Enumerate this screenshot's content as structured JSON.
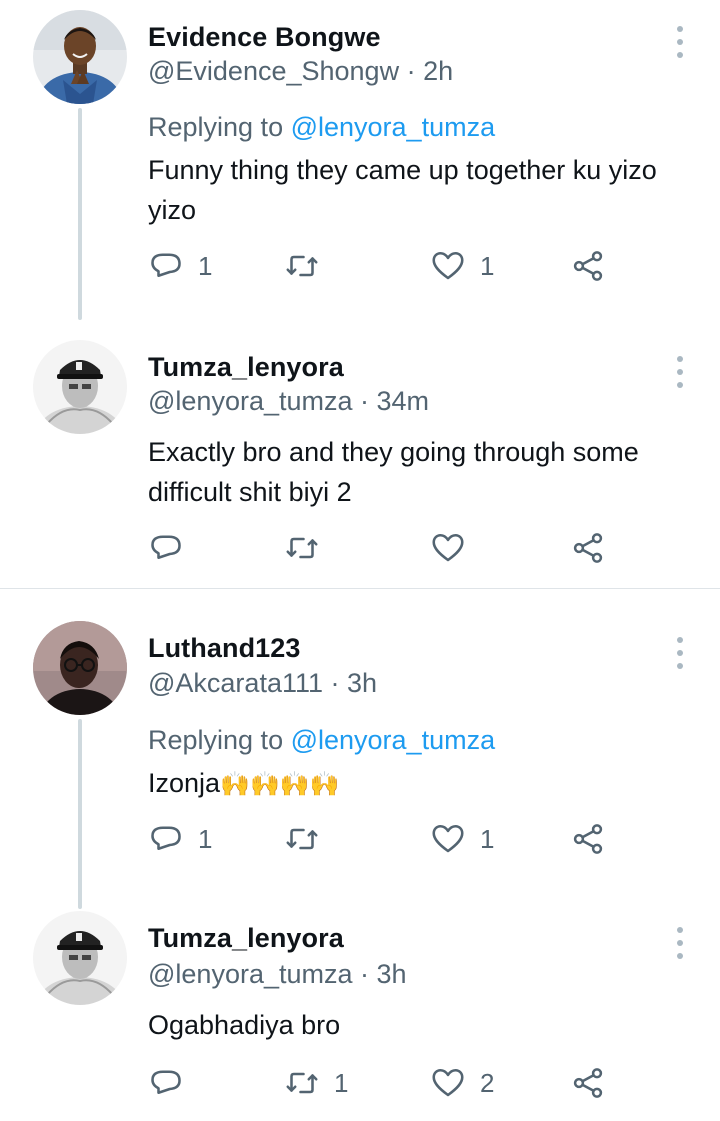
{
  "tweets": [
    {
      "name": "Evidence Bongwe",
      "handle": "@Evidence_Shongw",
      "time": "2h",
      "replying_label": "Replying to ",
      "replying_to": "@lenyora_tumza",
      "text": "Funny thing they came up together ku yizo yizo",
      "replies": "1",
      "retweets": "",
      "likes": "1"
    },
    {
      "name": "Tumza_lenyora",
      "handle": "@lenyora_tumza",
      "time": "34m",
      "text": "Exactly bro and they going through some difficult shit biyi 2",
      "replies": "",
      "retweets": "",
      "likes": ""
    },
    {
      "name": "Luthand123",
      "handle": "@Akcarata111",
      "time": "3h",
      "replying_label": "Replying to ",
      "replying_to": "@lenyora_tumza",
      "text": "Izonja",
      "text_emoji": "🙌🙌🙌🙌",
      "replies": "1",
      "retweets": "",
      "likes": "1"
    },
    {
      "name": "Tumza_lenyora",
      "handle": "@lenyora_tumza",
      "time": "3h",
      "text": "Ogabhadiya bro",
      "replies": "",
      "retweets": "1",
      "likes": "2"
    }
  ],
  "separator": " · ",
  "icons": {
    "reply": "reply-icon",
    "retweet": "retweet-icon",
    "like": "heart-icon",
    "share": "share-icon",
    "more": "more-vertical-icon"
  },
  "colors": {
    "text": "#0f1419",
    "secondary": "#536471",
    "mention": "#1d9bf0",
    "thread_line": "#cfd9de"
  }
}
